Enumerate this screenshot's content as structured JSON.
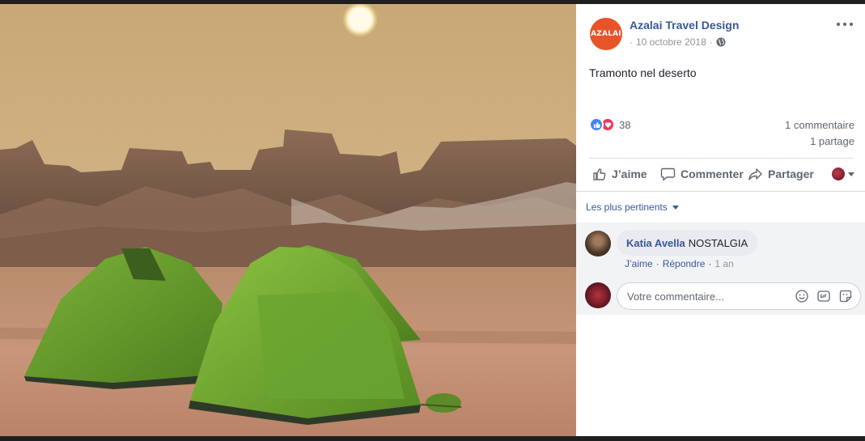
{
  "post": {
    "page_name": "Azalai Travel Design",
    "avatar_logo": "AZALAI",
    "date": "10 octobre 2018",
    "privacy_icon": "globe-icon",
    "text": "Tramonto nel deserto",
    "reaction_count": "38",
    "comments_count": "1 commentaire",
    "shares_count": "1 partage"
  },
  "actions": {
    "like_label": "J’aime",
    "comment_label": "Commenter",
    "share_label": "Partager"
  },
  "comments": {
    "sort_label": "Les plus pertinents",
    "items": [
      {
        "author": "Katia Avella",
        "text": "NOSTALGIA",
        "like_link": "J’aime",
        "reply_link": "Répondre",
        "time": "1 an"
      }
    ],
    "composer_placeholder": "Votre commentaire..."
  },
  "colors": {
    "link_blue": "#385898",
    "like_blue": "#4a82f2",
    "love_red": "#f0375a",
    "text_gray": "#606770",
    "avatar_orange": "#e8542a"
  }
}
